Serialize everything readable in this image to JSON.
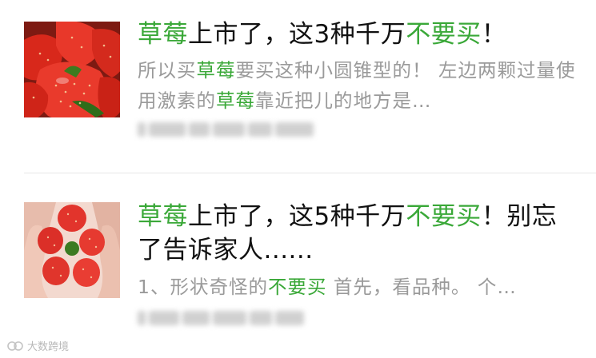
{
  "articles": [
    {
      "title_parts": [
        {
          "text": "草莓",
          "hl": true
        },
        {
          "text": "上市了，这3种千万",
          "hl": false
        },
        {
          "text": "不要买",
          "hl": true
        },
        {
          "text": "！",
          "hl": false
        }
      ],
      "summary_parts": [
        {
          "text": "所以买",
          "hl": false
        },
        {
          "text": "草莓",
          "hl": true
        },
        {
          "text": "要买这种小圆锥型的！ 左边两颗过量使用激素的",
          "hl": false
        },
        {
          "text": "草莓",
          "hl": true
        },
        {
          "text": "靠近把儿的地方是…",
          "hl": false
        }
      ],
      "thumbnail_icon": "strawberries-photo"
    },
    {
      "title_parts": [
        {
          "text": "草莓",
          "hl": true
        },
        {
          "text": "上市了，这5种千万",
          "hl": false
        },
        {
          "text": "不要买",
          "hl": true
        },
        {
          "text": "！别忘了告诉家人......",
          "hl": false
        }
      ],
      "summary_parts": [
        {
          "text": "1、形状奇怪的",
          "hl": false
        },
        {
          "text": "不要买",
          "hl": true
        },
        {
          "text": " 首先，看品种。 个…",
          "hl": false
        }
      ],
      "thumbnail_icon": "strawberries-in-hands-photo"
    }
  ],
  "watermark": {
    "text": "大数跨境"
  },
  "colors": {
    "highlight": "#3aa838",
    "title": "#111111",
    "summary": "#9a9a9a"
  }
}
